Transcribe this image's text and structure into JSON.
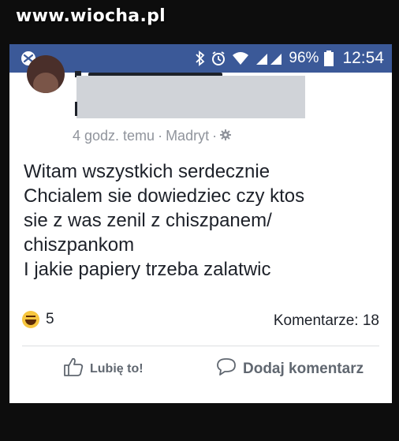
{
  "watermark": "www.wiocha.pl",
  "statusbar": {
    "battery": "96%",
    "time": "12:54",
    "icons": [
      "notification-icon",
      "bluetooth-icon",
      "alarm-icon",
      "wifi-icon",
      "signal-icon",
      "battery-icon"
    ],
    "background": "#3b5998"
  },
  "post": {
    "meta_time": "4 godz. temu",
    "meta_separator": "·",
    "meta_location": "Madryt",
    "meta_separator2": "·",
    "body_lines": [
      "Witam wszystkich serdecznie",
      "Chcialem sie dowiedziec czy ktos",
      "sie z was zenil z chiszpanem/",
      "chiszpankom",
      "I jakie papiery trzeba zalatwic"
    ],
    "reaction_count": "5",
    "comments_label": "Komentarze: 18"
  },
  "actions": {
    "like_label": "Lubię to!",
    "comment_label": "Dodaj komentarz"
  }
}
